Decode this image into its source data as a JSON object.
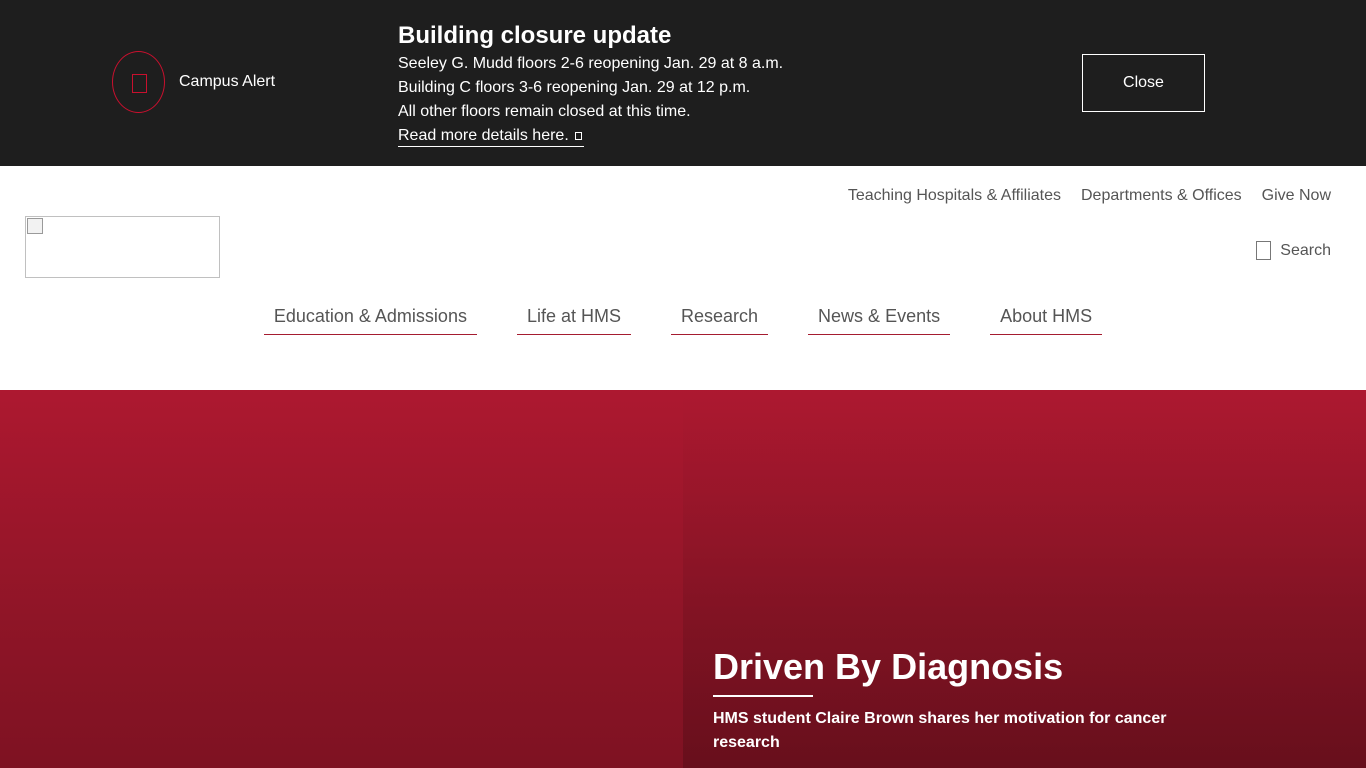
{
  "alert": {
    "label": "Campus Alert",
    "icon": "alert-icon",
    "title": "Building closure update",
    "lines": [
      "Seeley G. Mudd floors 2-6 reopening Jan. 29 at 8 a.m.",
      "Building C floors 3-6 reopening Jan. 29 at 12 p.m.",
      "All other floors remain closed at this time."
    ],
    "link_text": "Read more details here.",
    "link_icon": "external-link-icon",
    "close_label": "Close"
  },
  "utility_nav": [
    {
      "label": "Teaching Hospitals & Affiliates"
    },
    {
      "label": "Departments & Offices"
    },
    {
      "label": "Give Now"
    }
  ],
  "search": {
    "label": "Search",
    "icon": "search-icon"
  },
  "main_nav": [
    {
      "label": "Education & Admissions"
    },
    {
      "label": "Life at HMS"
    },
    {
      "label": "Research"
    },
    {
      "label": "News & Events"
    },
    {
      "label": "About HMS"
    }
  ],
  "hero": {
    "title": "Driven By Diagnosis",
    "subtitle": "HMS student Claire Brown shares her motivation for cancer research"
  },
  "colors": {
    "alert_background": "#1e1e1e",
    "accent": "#c8102e",
    "hero_red": "#a51c30",
    "nav_text": "#555555"
  }
}
